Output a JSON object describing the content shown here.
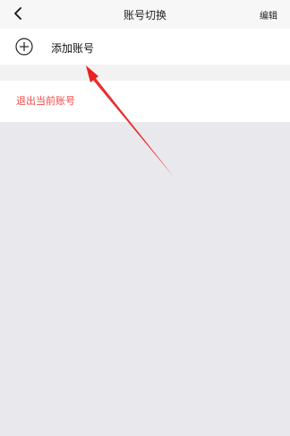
{
  "header": {
    "title": "账号切换",
    "edit_label": "编辑",
    "back_icon": "chevron-left-icon"
  },
  "accounts": {
    "add_label": "添加账号",
    "add_icon": "plus-circle-icon"
  },
  "logout": {
    "label": "退出当前账号",
    "color": "#f24a4a"
  },
  "annotation": {
    "arrow_color": "#e8231f"
  }
}
